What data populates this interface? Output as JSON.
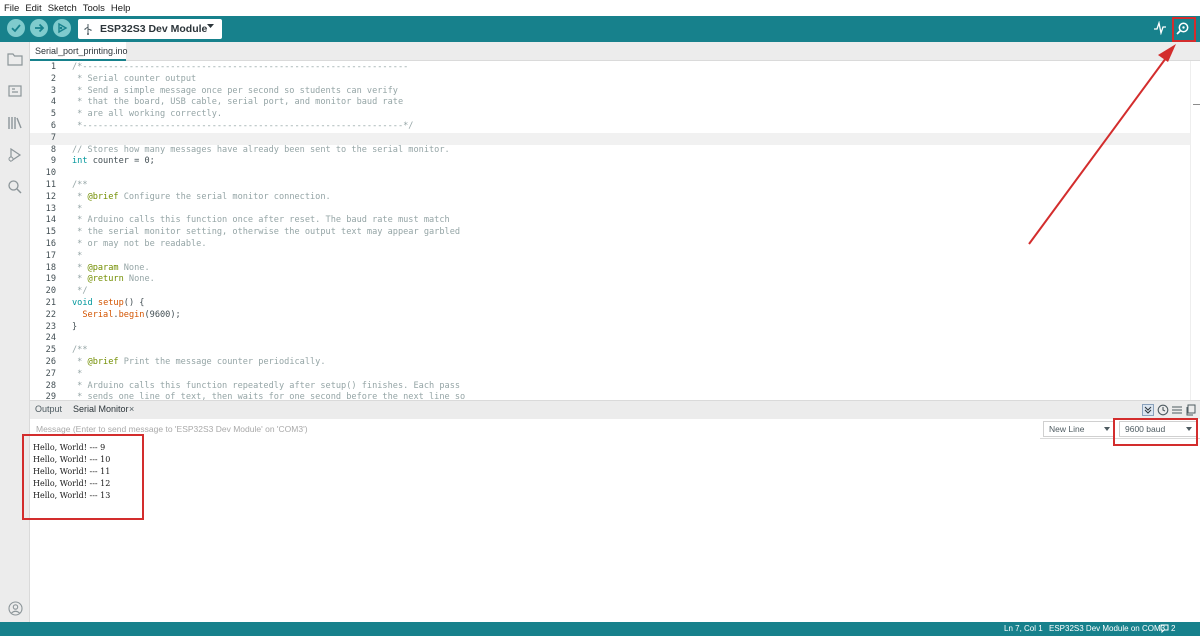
{
  "menu": [
    "File",
    "Edit",
    "Sketch",
    "Tools",
    "Help"
  ],
  "toolbar": {
    "board": "ESP32S3 Dev Module",
    "verify_icon": "check-icon",
    "upload_icon": "arrow-right-icon",
    "debug_icon": "debug-icon",
    "plotter_icon": "plotter-icon",
    "serial_monitor_icon": "magnifier-icon"
  },
  "tab": {
    "filename": "Serial_port_printing.ino"
  },
  "editor": {
    "lines": [
      {
        "n": "1",
        "t": "/*---------------------------------------------------------------",
        "k": "c"
      },
      {
        "n": "2",
        "t": " * Serial counter output",
        "k": "c"
      },
      {
        "n": "3",
        "t": " * Send a simple message once per second so students can verify",
        "k": "c"
      },
      {
        "n": "4",
        "t": " * that the board, USB cable, serial port, and monitor baud rate",
        "k": "c"
      },
      {
        "n": "5",
        "t": " * are all working correctly.",
        "k": "c"
      },
      {
        "n": "6",
        "t": " *--------------------------------------------------------------*/",
        "k": "c"
      },
      {
        "n": "7",
        "t": "",
        "k": "c"
      },
      {
        "n": "8",
        "t": "// Stores how many messages have already been sent to the serial monitor.",
        "k": "c"
      },
      {
        "n": "9",
        "t": "int counter = 0;",
        "k": "x"
      },
      {
        "n": "10",
        "t": "",
        "k": "c"
      },
      {
        "n": "11",
        "t": "/**",
        "k": "c"
      },
      {
        "n": "12",
        "t": " * @brief Configure the serial monitor connection.",
        "k": "c"
      },
      {
        "n": "13",
        "t": " *",
        "k": "c"
      },
      {
        "n": "14",
        "t": " * Arduino calls this function once after reset. The baud rate must match",
        "k": "c"
      },
      {
        "n": "15",
        "t": " * the serial monitor setting, otherwise the output text may appear garbled",
        "k": "c"
      },
      {
        "n": "16",
        "t": " * or may not be readable.",
        "k": "c"
      },
      {
        "n": "17",
        "t": " *",
        "k": "c"
      },
      {
        "n": "18",
        "t": " * @param None.",
        "k": "c"
      },
      {
        "n": "19",
        "t": " * @return None.",
        "k": "c"
      },
      {
        "n": "20",
        "t": " */",
        "k": "c"
      },
      {
        "n": "21",
        "t": "void setup() {",
        "k": "x"
      },
      {
        "n": "22",
        "t": "  Serial.begin(9600);",
        "k": "x"
      },
      {
        "n": "23",
        "t": "}",
        "k": "x"
      },
      {
        "n": "24",
        "t": "",
        "k": "c"
      },
      {
        "n": "25",
        "t": "/**",
        "k": "c"
      },
      {
        "n": "26",
        "t": " * @brief Print the message counter periodically.",
        "k": "c"
      },
      {
        "n": "27",
        "t": " *",
        "k": "c"
      },
      {
        "n": "28",
        "t": " * Arduino calls this function repeatedly after setup() finishes. Each pass",
        "k": "c"
      },
      {
        "n": "29",
        "t": " * sends one line of text, then waits for one second before the next line so",
        "k": "c"
      }
    ]
  },
  "panel": {
    "tab_output": "Output",
    "tab_serial": "Serial Monitor",
    "close": "×",
    "message_placeholder": "Message (Enter to send message to 'ESP32S3 Dev Module' on 'COM3')",
    "line_ending": "New Line",
    "baud": "9600 baud",
    "output": [
      "Hello, World! --- 9",
      "Hello, World! --- 10",
      "Hello, World! --- 11",
      "Hello, World! --- 12",
      "Hello, World! --- 13"
    ]
  },
  "status": {
    "position": "Ln 7, Col 1",
    "board_port": "ESP32S3 Dev Module on COM3",
    "notifications": "2"
  },
  "colors": {
    "toolbar": "#17818c",
    "annotation": "#d32d2d",
    "keyword": "#00979c",
    "function": "#d35400",
    "doxygen": "#728e00"
  }
}
